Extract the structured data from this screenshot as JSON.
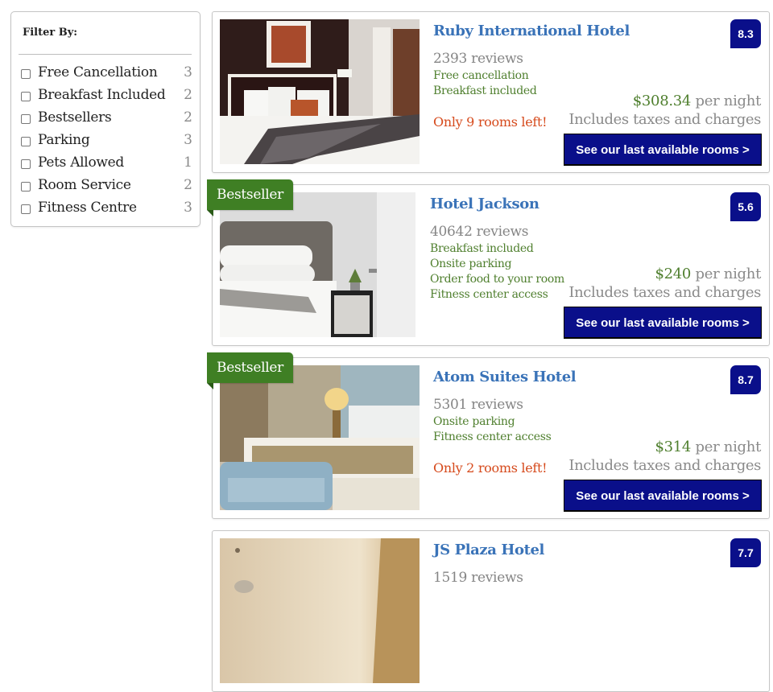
{
  "filter": {
    "title": "Filter By:",
    "items": [
      {
        "label": "Free Cancellation",
        "count": "3",
        "checked": false
      },
      {
        "label": "Breakfast Included",
        "count": "2",
        "checked": false
      },
      {
        "label": "Bestsellers",
        "count": "2",
        "checked": false
      },
      {
        "label": "Parking",
        "count": "3",
        "checked": false
      },
      {
        "label": "Pets Allowed",
        "count": "1",
        "checked": false
      },
      {
        "label": "Room Service",
        "count": "2",
        "checked": false
      },
      {
        "label": "Fitness Centre",
        "count": "3",
        "checked": false
      }
    ]
  },
  "hotels": [
    {
      "name": "Ruby International Hotel",
      "reviews": "2393 reviews",
      "amenities": [
        "Free cancellation",
        "Breakfast included"
      ],
      "scarcity": "Only 9 rooms left!",
      "rating": "8.3",
      "price": "$308.34",
      "price_suffix": " per night",
      "taxes": "Includes taxes and charges",
      "cta": "See our last available rooms >",
      "bestseller": "",
      "image": "hotel-room-dark-headboard-photo"
    },
    {
      "name": "Hotel Jackson",
      "reviews": "40642 reviews",
      "amenities": [
        "Breakfast included",
        "Onsite parking",
        "Order food to your room",
        "Fitness center access"
      ],
      "scarcity": "",
      "rating": "5.6",
      "price": "$240",
      "price_suffix": " per night",
      "taxes": "Includes taxes and charges",
      "cta": "See our last available rooms >",
      "bestseller": "Bestseller",
      "image": "bedroom-grey-headboard-photo"
    },
    {
      "name": "Atom Suites Hotel",
      "reviews": "5301 reviews",
      "amenities": [
        "Onsite parking",
        "Fitness center access"
      ],
      "scarcity": "Only 2 rooms left!",
      "rating": "8.7",
      "price": "$314",
      "price_suffix": " per night",
      "taxes": "Includes taxes and charges",
      "cta": "See our last available rooms >",
      "bestseller": "Bestseller",
      "image": "suite-blue-bench-photo"
    },
    {
      "name": "JS Plaza Hotel",
      "reviews": "1519 reviews",
      "amenities": [],
      "scarcity": "",
      "rating": "7.7",
      "price": "",
      "price_suffix": "",
      "taxes": "",
      "cta": "",
      "bestseller": "",
      "image": "hotel-room-warm-light-photo"
    }
  ],
  "colors": {
    "rating_bg": "#0a0f8a",
    "cta_bg": "#0a0f8a",
    "hotel_name": "#3a73b8",
    "amenity": "#4f7f2e",
    "price": "#4f7f2e",
    "scarcity": "#d64a1c",
    "bestseller_bg": "#3f7f24"
  }
}
